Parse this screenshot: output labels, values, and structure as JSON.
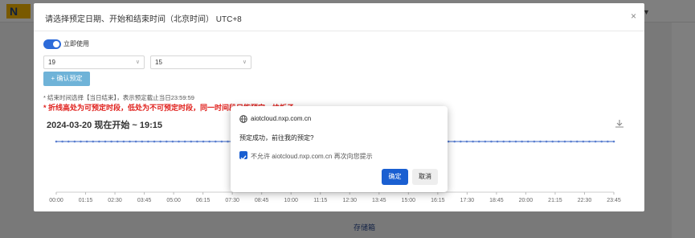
{
  "dialog": {
    "title": "请选择预定日期、开始和结束时间（北京时间） UTC+8",
    "close_glyph": "×",
    "toggle_label": "立即使用",
    "hour_select": "19",
    "minute_select": "15",
    "confirm_preset_label": "+ 确认预定",
    "note_gray": "* 结束时间选择【当日结束】，表示预定截止当日23:59:59",
    "note_red": "* 折线高处为可预定时段，低处为不可预定时段，同一时间段只能预定一块板子",
    "chart_title": "2024-03-20 现在开始 ~ 19:15",
    "select_chevron": "∨"
  },
  "chart_data": {
    "type": "line",
    "x": [
      "00:00",
      "01:15",
      "02:30",
      "03:45",
      "05:00",
      "06:15",
      "07:30",
      "08:45",
      "10:00",
      "11:15",
      "12:30",
      "13:45",
      "15:00",
      "16:15",
      "17:30",
      "18:45",
      "20:00",
      "21:15",
      "22:30",
      "23:45"
    ],
    "series_color": "#5b7fcf",
    "description_values": "flat high line across all time slots",
    "values": [
      1,
      1,
      1,
      1,
      1,
      1,
      1,
      1,
      1,
      1,
      1,
      1,
      1,
      1,
      1,
      1,
      1,
      1,
      1,
      1
    ]
  },
  "popup": {
    "host": "aiotcloud.nxp.com.cn",
    "message": "预定成功，前往我的预定?",
    "checkbox_label": "不允许 aiotcloud.nxp.com.cn 再次向您提示",
    "ok_label": "确定",
    "cancel_label": "取消"
  },
  "background": {
    "bottom_button": "存储箱"
  },
  "colors": {
    "primary": "#1a5fd1",
    "toggle": "#2d6bd9",
    "warning_red": "#e0201c",
    "preset_button": "#6fb3d8"
  }
}
